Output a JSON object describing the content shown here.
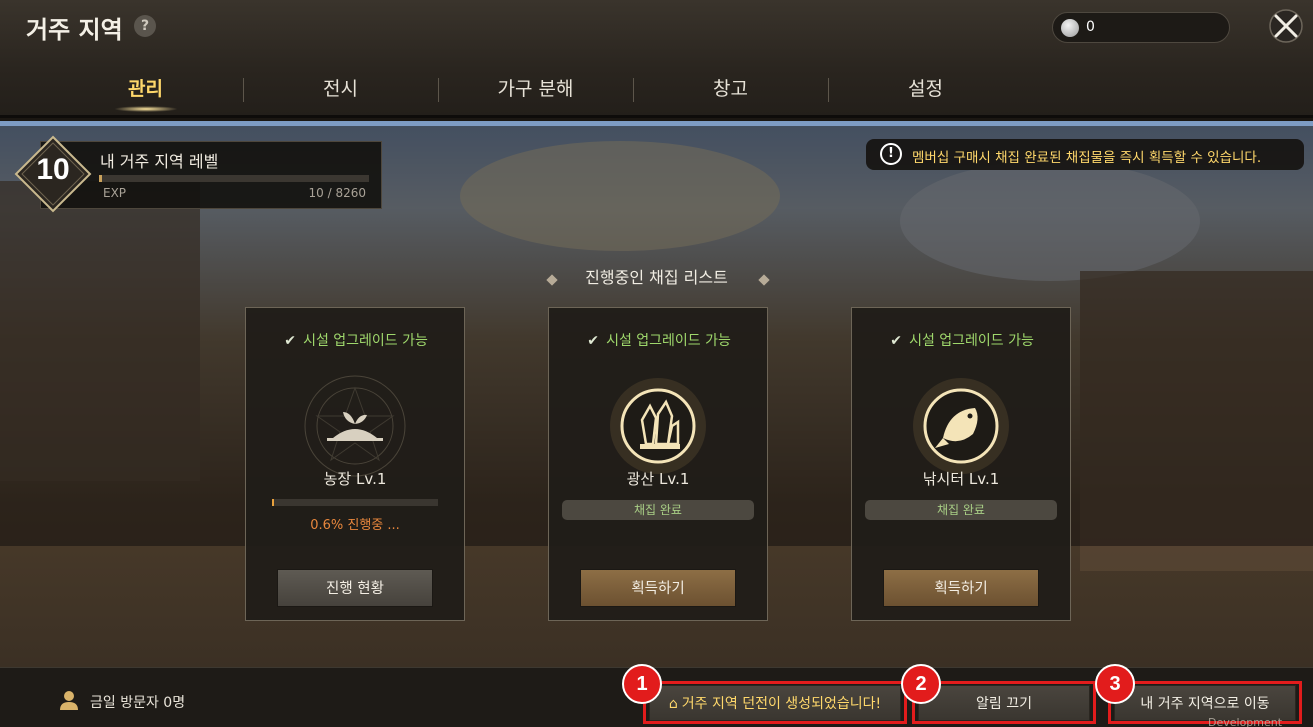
{
  "header": {
    "title": "거주 지역",
    "help_label": "?",
    "currency_value": "0",
    "tabs": [
      {
        "label": "관리",
        "active": true
      },
      {
        "label": "전시",
        "active": false
      },
      {
        "label": "가구 분해",
        "active": false
      },
      {
        "label": "창고",
        "active": false
      },
      {
        "label": "설정",
        "active": false
      }
    ]
  },
  "level": {
    "number": "10",
    "label": "내 거주 지역 레벨",
    "exp_label": "EXP",
    "exp_value": "10 / 8260",
    "exp_fraction": 0.0012
  },
  "notice": {
    "icon": "!",
    "text": "멤버십 구매시 채집 완료된 채집물을 즉시 획득할 수 있습니다."
  },
  "gathering": {
    "title": "진행중인 채집 리스트",
    "cards": [
      {
        "upgrade_label": "시설 업그레이드 가능",
        "icon": "farm-sprout-icon",
        "name": "농장 Lv.1",
        "progress_fraction": 0.006,
        "progress_text": "0.6% 진행중 ...",
        "button_label": "진행 현황"
      },
      {
        "upgrade_label": "시설 업그레이드 가능",
        "icon": "mine-crystal-icon",
        "name": "광산 Lv.1",
        "status_text": "채집 완료",
        "button_label": "획득하기"
      },
      {
        "upgrade_label": "시설 업그레이드 가능",
        "icon": "fish-icon",
        "name": "낚시터 Lv.1",
        "status_text": "채집 완료",
        "button_label": "획득하기"
      }
    ]
  },
  "bottom": {
    "visitor_text": "금일 방문자 0명",
    "dungeon_button": "거주 지역 던전이 생성되었습니다!",
    "alarm_button": "알림 끄기",
    "move_button": "내 거주 지역으로 이동",
    "badges": [
      "1",
      "2",
      "3"
    ],
    "dev_text": "Development Build"
  },
  "colors": {
    "accent_gold": "#ffd86b",
    "upgrade_green": "#9fd86c",
    "progress_orange": "#e8873d",
    "highlight_red": "#e21c1c"
  }
}
